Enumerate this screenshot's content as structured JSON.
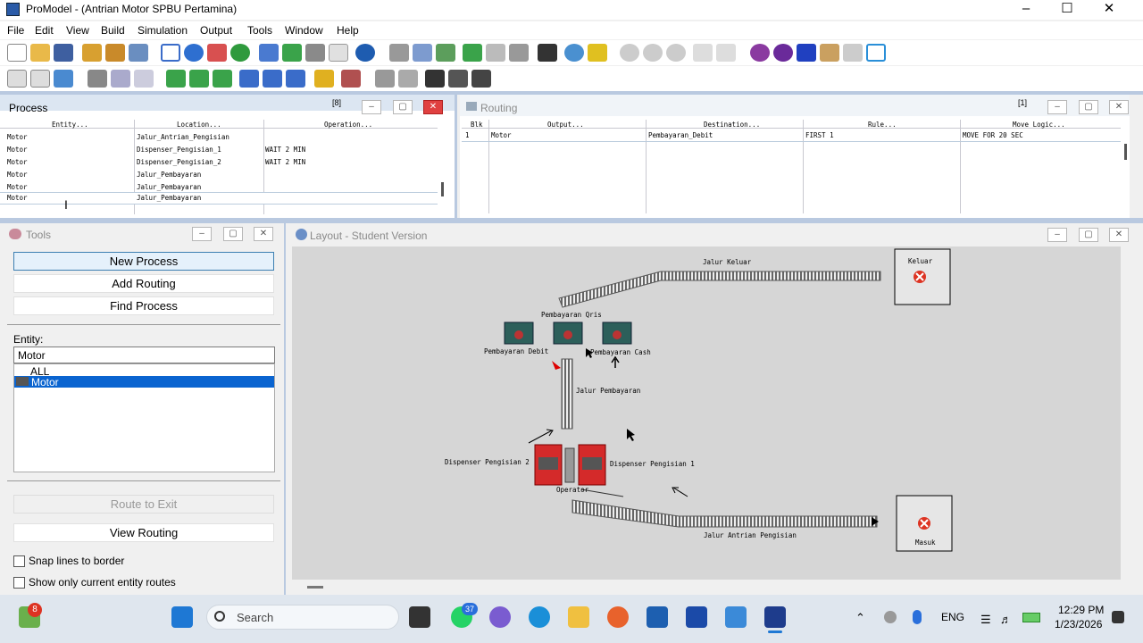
{
  "window": {
    "title": "ProModel - (Antrian Motor SPBU Pertamina)"
  },
  "menu": [
    "File",
    "Edit",
    "View",
    "Build",
    "Simulation",
    "Output",
    "Tools",
    "Window",
    "Help"
  ],
  "process": {
    "title": "Process",
    "count": "[8]",
    "columns": [
      "Entity...",
      "Location...",
      "Operation..."
    ],
    "rows": [
      {
        "entity": "Motor",
        "location": "Jalur_Antrian_Pengisian",
        "operation": ""
      },
      {
        "entity": "Motor",
        "location": "Dispenser_Pengisian_1",
        "operation": "WAIT 2 MIN"
      },
      {
        "entity": "Motor",
        "location": "Dispenser_Pengisian_2",
        "operation": "WAIT 2 MIN"
      },
      {
        "entity": "Motor",
        "location": "Jalur_Pembayaran",
        "operation": ""
      },
      {
        "entity": "Motor",
        "location": "Jalur_Pembayaran",
        "operation": ""
      },
      {
        "entity": "Motor",
        "location": "Jalur_Pembayaran",
        "operation": ""
      }
    ]
  },
  "routing": {
    "title": "Routing",
    "count": "[1]",
    "columns": [
      "Blk",
      "Output...",
      "Destination...",
      "Rule...",
      "Move Logic..."
    ],
    "rows": [
      {
        "blk": "1",
        "output": "Motor",
        "destination": "Pembayaran_Debit",
        "rule": "FIRST 1",
        "move": "MOVE FOR 20 SEC"
      }
    ]
  },
  "tools": {
    "title": "Tools",
    "new_process": "New Process",
    "add_routing": "Add Routing",
    "find_process": "Find Process",
    "entity_label": "Entity:",
    "entity_value": "Motor",
    "entity_list": [
      "ALL",
      "Motor"
    ],
    "route_to_exit": "Route to Exit",
    "view_routing": "View Routing",
    "snap_lines": "Snap lines to border",
    "show_only": "Show only current entity routes"
  },
  "layout": {
    "title": "Layout - Student Version",
    "labels": {
      "jalur_keluar": "Jalur Keluar",
      "keluar": "Keluar",
      "pembayaran_qris": "Pembayaran Qris",
      "pembayaran_debit": "Pembayaran Debit",
      "pembayaran_cash": "Pembayaran Cash",
      "jalur_pembayaran": "Jalur Pembayaran",
      "dispenser_2": "Dispenser Pengisian 2",
      "dispenser_1": "Dispenser Pengisian 1",
      "operator": "Operator",
      "jalur_antrian": "Jalur Antrian Pengisian",
      "masuk": "Masuk"
    }
  },
  "taskbar": {
    "search": "Search",
    "badge_left": "8",
    "badge_whatsapp": "37",
    "lang": "ENG",
    "time": "12:29 PM",
    "date": "1/23/2026"
  }
}
